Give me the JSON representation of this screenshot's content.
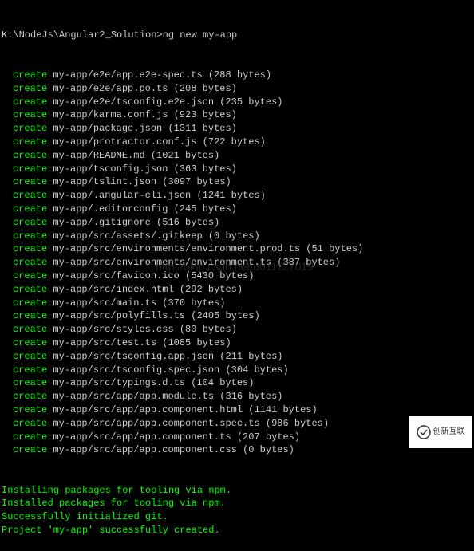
{
  "prompt": "K:\\NodeJs\\Angular2_Solution>ng new my-app",
  "create_label": "create",
  "files": [
    {
      "path": "my-app/e2e/app.e2e-spec.ts",
      "bytes": "(288 bytes)"
    },
    {
      "path": "my-app/e2e/app.po.ts",
      "bytes": "(208 bytes)"
    },
    {
      "path": "my-app/e2e/tsconfig.e2e.json",
      "bytes": "(235 bytes)"
    },
    {
      "path": "my-app/karma.conf.js",
      "bytes": "(923 bytes)"
    },
    {
      "path": "my-app/package.json",
      "bytes": "(1311 bytes)"
    },
    {
      "path": "my-app/protractor.conf.js",
      "bytes": "(722 bytes)"
    },
    {
      "path": "my-app/README.md",
      "bytes": "(1021 bytes)"
    },
    {
      "path": "my-app/tsconfig.json",
      "bytes": "(363 bytes)"
    },
    {
      "path": "my-app/tslint.json",
      "bytes": "(3097 bytes)"
    },
    {
      "path": "my-app/.angular-cli.json",
      "bytes": "(1241 bytes)"
    },
    {
      "path": "my-app/.editorconfig",
      "bytes": "(245 bytes)"
    },
    {
      "path": "my-app/.gitignore",
      "bytes": "(516 bytes)"
    },
    {
      "path": "my-app/src/assets/.gitkeep",
      "bytes": "(0 bytes)"
    },
    {
      "path": "my-app/src/environments/environment.prod.ts",
      "bytes": "(51 bytes)"
    },
    {
      "path": "my-app/src/environments/environment.ts",
      "bytes": "(387 bytes)"
    },
    {
      "path": "my-app/src/favicon.ico",
      "bytes": "(5430 bytes)"
    },
    {
      "path": "my-app/src/index.html",
      "bytes": "(292 bytes)"
    },
    {
      "path": "my-app/src/main.ts",
      "bytes": "(370 bytes)"
    },
    {
      "path": "my-app/src/polyfills.ts",
      "bytes": "(2405 bytes)"
    },
    {
      "path": "my-app/src/styles.css",
      "bytes": "(80 bytes)"
    },
    {
      "path": "my-app/src/test.ts",
      "bytes": "(1085 bytes)"
    },
    {
      "path": "my-app/src/tsconfig.app.json",
      "bytes": "(211 bytes)"
    },
    {
      "path": "my-app/src/tsconfig.spec.json",
      "bytes": "(304 bytes)"
    },
    {
      "path": "my-app/src/typings.d.ts",
      "bytes": "(104 bytes)"
    },
    {
      "path": "my-app/src/app/app.module.ts",
      "bytes": "(316 bytes)"
    },
    {
      "path": "my-app/src/app/app.component.html",
      "bytes": "(1141 bytes)"
    },
    {
      "path": "my-app/src/app/app.component.spec.ts",
      "bytes": "(986 bytes)"
    },
    {
      "path": "my-app/src/app/app.component.ts",
      "bytes": "(207 bytes)"
    },
    {
      "path": "my-app/src/app/app.component.css",
      "bytes": "(0 bytes)"
    }
  ],
  "status_lines": [
    "Installing packages for tooling via npm.",
    "Installed packages for tooling via npm.",
    "Successfully initialized git.",
    "Project 'my-app' successfully created."
  ],
  "watermark": "http://blog.csdn.net/u011127019",
  "badge_text": "创新互联"
}
